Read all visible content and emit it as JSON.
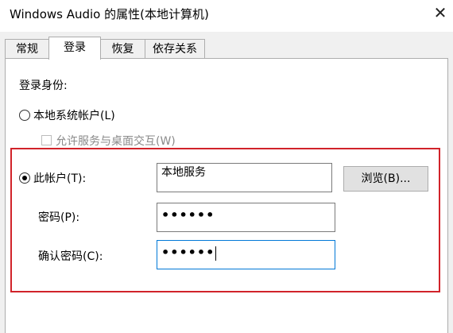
{
  "window": {
    "title": "Windows Audio 的属性(本地计算机)",
    "close_symbol": "✕"
  },
  "tabs": [
    {
      "label": "常规",
      "active": false
    },
    {
      "label": "登录",
      "active": true
    },
    {
      "label": "恢复",
      "active": false
    },
    {
      "label": "依存关系",
      "active": false
    }
  ],
  "logon": {
    "section_label": "登录身份:",
    "local_system_label": "本地系统帐户(L)",
    "local_system_checked": false,
    "interact_desktop_label": "允许服务与桌面交互(W)",
    "interact_desktop_checked": false,
    "interact_desktop_enabled": false,
    "this_account_label": "此帐户(T):",
    "this_account_checked": true,
    "account_value": "本地服务",
    "browse_label": "浏览(B)...",
    "password_label": "密码(P):",
    "password_value": "••••••",
    "confirm_label": "确认密码(C):",
    "confirm_value": "••••••"
  },
  "colors": {
    "highlight_border": "#d1232a",
    "focus_border": "#0078d7"
  }
}
